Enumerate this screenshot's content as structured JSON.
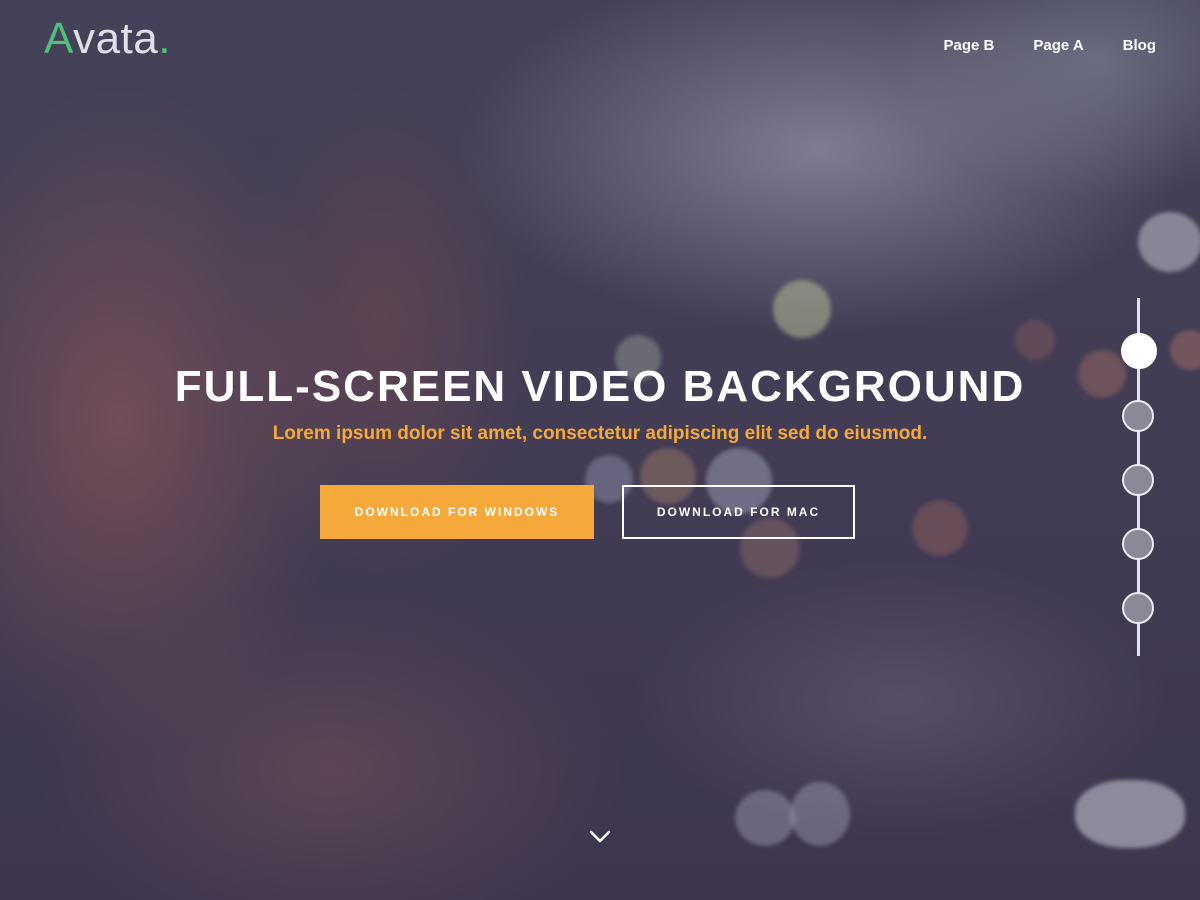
{
  "brand": {
    "logo_first": "A",
    "logo_rest": "vata",
    "logo_dot": ".",
    "accent_color": "#4fbf7a"
  },
  "nav": {
    "items": [
      {
        "label": "Page B"
      },
      {
        "label": "Page A"
      },
      {
        "label": "Blog"
      }
    ]
  },
  "hero": {
    "title": "FULL-SCREEN VIDEO BACKGROUND",
    "subtitle": "Lorem ipsum dolor sit amet, consectetur adipiscing elit sed do eiusmod.",
    "subtitle_color": "#f5a93a",
    "primary_button": "DOWNLOAD FOR WINDOWS",
    "primary_button_color": "#f6a93b",
    "secondary_button": "DOWNLOAD FOR MAC",
    "scroll_icon": "chevron-down-icon"
  },
  "section_nav": {
    "dot_count": 5,
    "active_index": 0
  }
}
